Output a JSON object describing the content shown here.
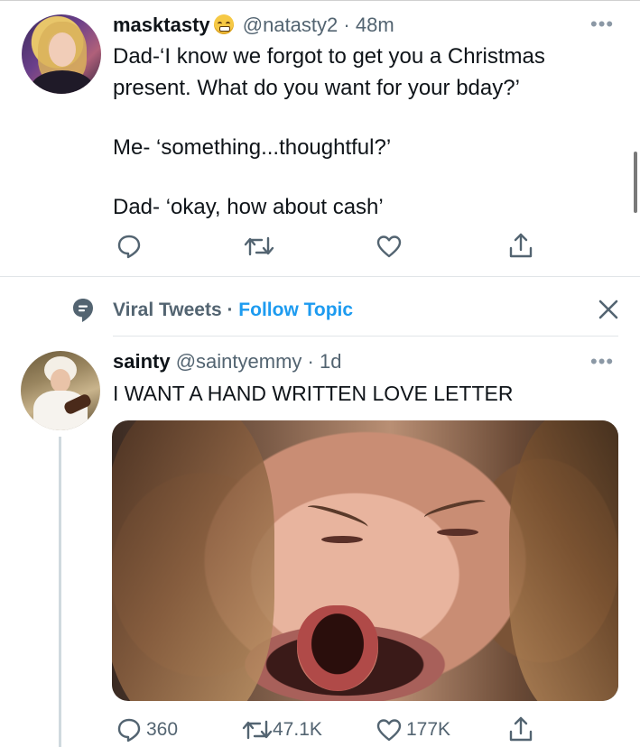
{
  "tweet1": {
    "display_name": "masktasty",
    "name_emoji": "grimacing-face-emoji",
    "handle": "@natasty2",
    "separator": "·",
    "time": "48m",
    "text_lines": [
      "Dad-‘I know we forgot to get you a Christmas",
      "present. What do you want for your bday?’",
      "",
      "Me- ‘something...thoughtful?’",
      "",
      "Dad- ‘okay, how about cash’"
    ],
    "actions": {
      "reply_icon": "reply-bubble-icon",
      "retweet_icon": "retweet-icon",
      "like_icon": "heart-icon",
      "share_icon": "share-icon"
    }
  },
  "topic": {
    "icon": "topic-speech-bubble-icon",
    "name": "Viral Tweets",
    "separator": " · ",
    "follow_label": "Follow Topic",
    "close_icon": "close-icon"
  },
  "tweet2": {
    "display_name": "sainty",
    "handle": "@saintyemmy",
    "separator": "·",
    "time": "1d",
    "text": "I WANT A HAND WRITTEN LOVE LETTER",
    "media": "crying-woman-photo",
    "actions": {
      "reply_count": "360",
      "retweet_count": "47.1K",
      "like_count": "177K"
    }
  },
  "colors": {
    "text": "#0f1419",
    "secondary": "#536471",
    "link": "#1d9bf0",
    "divider": "#e1e5e8"
  }
}
